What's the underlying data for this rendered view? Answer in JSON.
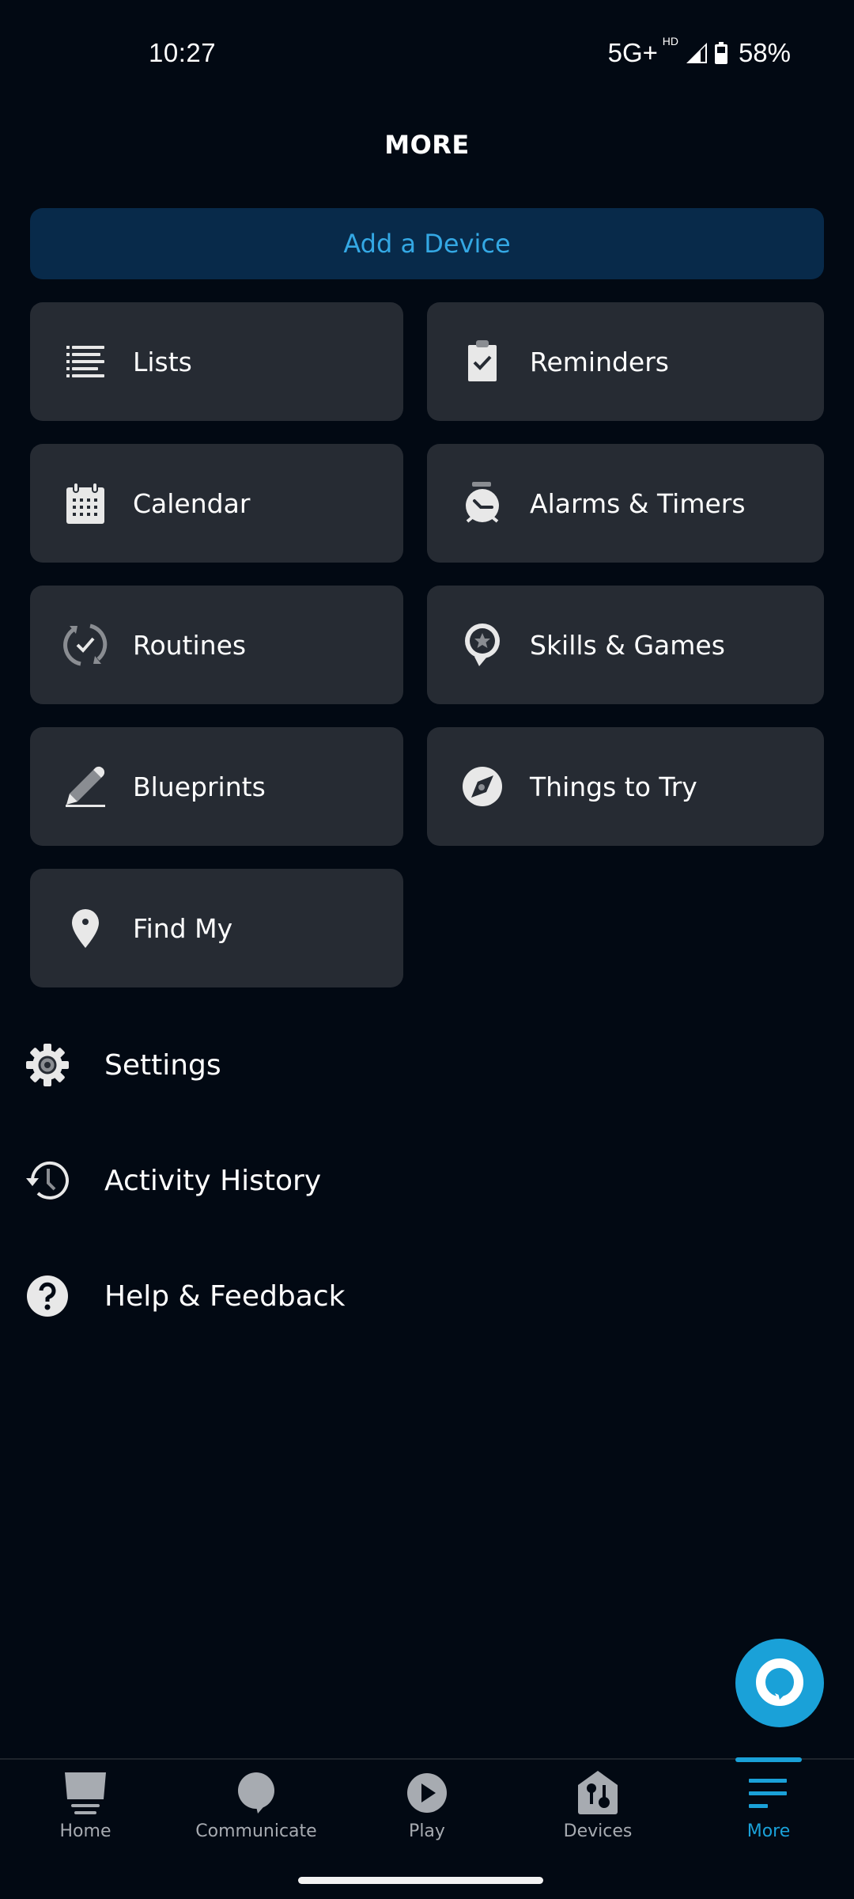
{
  "status_bar": {
    "time": "10:27",
    "network": "5G+",
    "network_badge": "HD",
    "signal_icon": "signal-icon",
    "battery_icon": "battery-icon",
    "battery": "58%"
  },
  "header": {
    "title": "MORE"
  },
  "add_device": {
    "label": "Add a Device"
  },
  "tiles": [
    {
      "label": "Lists",
      "icon": "list-icon"
    },
    {
      "label": "Reminders",
      "icon": "clipboard-check-icon"
    },
    {
      "label": "Calendar",
      "icon": "calendar-icon"
    },
    {
      "label": "Alarms & Timers",
      "icon": "alarm-clock-icon"
    },
    {
      "label": "Routines",
      "icon": "routines-icon"
    },
    {
      "label": "Skills & Games",
      "icon": "skills-icon"
    },
    {
      "label": "Blueprints",
      "icon": "pencil-icon"
    },
    {
      "label": "Things to Try",
      "icon": "compass-icon"
    },
    {
      "label": "Find My",
      "icon": "location-pin-icon"
    }
  ],
  "rows": [
    {
      "label": "Settings",
      "icon": "gear-icon"
    },
    {
      "label": "Activity History",
      "icon": "history-icon"
    },
    {
      "label": "Help & Feedback",
      "icon": "help-icon"
    }
  ],
  "alexa_button": {
    "icon": "alexa-icon"
  },
  "bottom_nav": {
    "active": "More",
    "items": [
      {
        "label": "Home",
        "icon": "home-icon"
      },
      {
        "label": "Communicate",
        "icon": "chat-bubble-icon"
      },
      {
        "label": "Play",
        "icon": "play-icon"
      },
      {
        "label": "Devices",
        "icon": "devices-icon"
      },
      {
        "label": "More",
        "icon": "menu-icon"
      }
    ]
  },
  "colors": {
    "background": "#020913",
    "tile": "#262b33",
    "accent": "#1aa1d8",
    "add_device_bg": "#082a4a",
    "add_device_text": "#34a8e4",
    "nav_inactive": "#a7abb1"
  }
}
